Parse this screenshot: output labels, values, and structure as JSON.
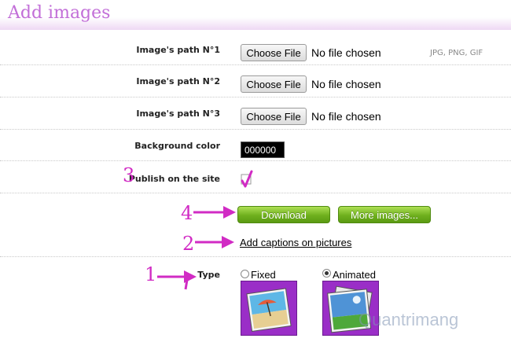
{
  "header": {
    "title": "Add images"
  },
  "form": {
    "image_rows": [
      {
        "label": "Image's path N°1",
        "button": "Choose File",
        "status": "No file chosen"
      },
      {
        "label": "Image's path N°2",
        "button": "Choose File",
        "status": "No file chosen"
      },
      {
        "label": "Image's path N°3",
        "button": "Choose File",
        "status": "No file chosen"
      }
    ],
    "formats_hint": "JPG, PNG, GIF",
    "background_color": {
      "label": "Background color",
      "value": "000000"
    },
    "publish": {
      "label": "Publish on the site",
      "checked": true
    },
    "download_button": "Download",
    "more_images_button": "More images...",
    "captions_link": "Add captions on pictures",
    "type": {
      "label": "Type",
      "options": [
        {
          "label": "Fixed",
          "selected": false,
          "icon": "beach-photo-icon"
        },
        {
          "label": "Animated",
          "selected": true,
          "icon": "stacked-photos-icon"
        }
      ]
    }
  },
  "annotations": {
    "numbers": [
      "1",
      "2",
      "3",
      "4"
    ],
    "color": "#d12bc4"
  },
  "watermark": "Quantrimang",
  "colors": {
    "title": "#c26fd8",
    "button_green": "#6fb01e",
    "thumbnail_purple": "#9a2ec7"
  }
}
